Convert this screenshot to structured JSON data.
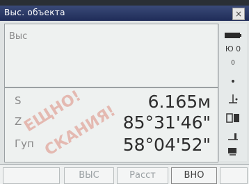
{
  "window": {
    "title": "Выс. объекта"
  },
  "panel": {
    "height_label": "Выс",
    "rows": [
      {
        "label": "S",
        "value": "6.165м"
      },
      {
        "label": "Z",
        "value": "85°31'46\""
      },
      {
        "label": "Гуп",
        "value": "58°04'52\""
      }
    ]
  },
  "sidebar": {
    "icons": [
      {
        "name": "battery-icon"
      },
      {
        "name": "face-indicator-icon",
        "text": "Ю 0"
      },
      {
        "name": "prism-constant-icon",
        "text": "0"
      },
      {
        "name": "dot-icon",
        "text": "•"
      },
      {
        "name": "tilt-icon"
      },
      {
        "name": "measure-mode-icon"
      },
      {
        "name": "target-icon"
      },
      {
        "name": "signal-icon"
      }
    ]
  },
  "softkeys": {
    "k1": "",
    "k2": "ВЫС",
    "k3": "Расст",
    "k4": "ВНО",
    "k5": ""
  },
  "watermark": {
    "line1": "ЕЩНО!",
    "line2": "СКАНИЯ!"
  }
}
